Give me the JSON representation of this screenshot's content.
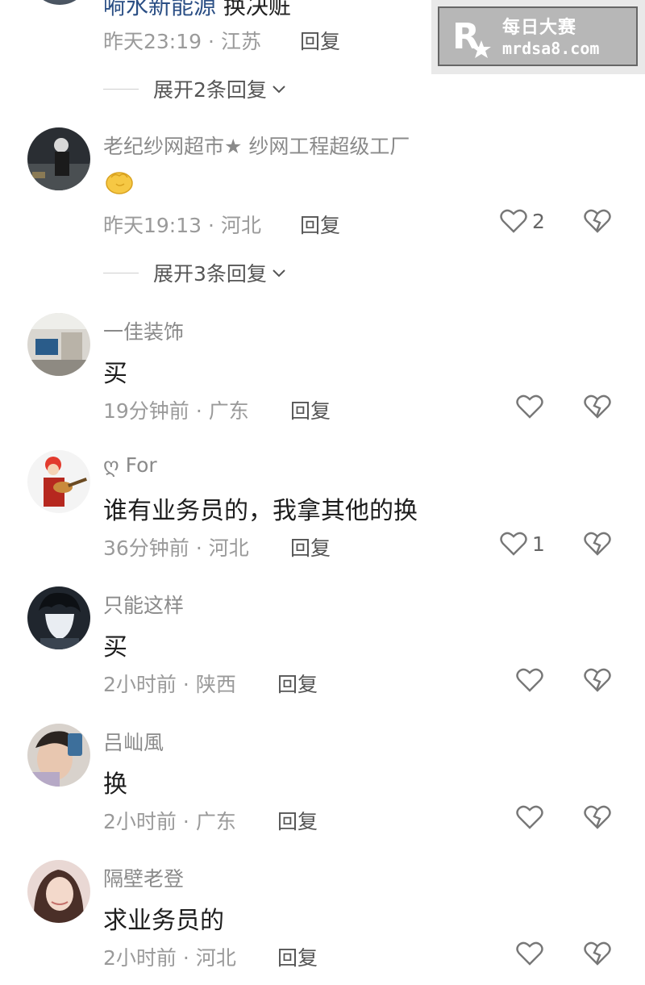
{
  "top_partial": {
    "name_text": "嗬水新能源",
    "rest_text": "换决赃",
    "meta_time": "昨天23:19",
    "meta_region": "江苏",
    "reply_label": "回复",
    "expand_label": "展开2条回复"
  },
  "comments": [
    {
      "username": "老纪纱网超市★ 纱网工程超级工厂",
      "content": "",
      "emoji": "fist-emoji",
      "time": "昨天19:13",
      "region": "河北",
      "reply_label": "回复",
      "like_count": "2",
      "expand_label": "展开3条回复"
    },
    {
      "username": "一佳装饰",
      "content": "买",
      "time": "19分钟前",
      "region": "广东",
      "reply_label": "回复",
      "like_count": ""
    },
    {
      "username": "ღ For",
      "content": "谁有业务员的，我拿其他的换",
      "time": "36分钟前",
      "region": "河北",
      "reply_label": "回复",
      "like_count": "1"
    },
    {
      "username": "只能这样",
      "content": "买",
      "time": "2小时前",
      "region": "陕西",
      "reply_label": "回复",
      "like_count": ""
    },
    {
      "username": "吕屾風",
      "content": "换",
      "time": "2小时前",
      "region": "广东",
      "reply_label": "回复",
      "like_count": ""
    },
    {
      "username": "隔壁老登",
      "content": "求业务员的",
      "time": "2小时前",
      "region": "河北",
      "reply_label": "回复",
      "like_count": ""
    }
  ],
  "meta_separator": "·",
  "watermark": {
    "title": "每日大赛",
    "url": "mrdsa8.com",
    "logo_letter": "R"
  },
  "colors": {
    "username": "#8a8a8a",
    "content": "#1d1d1d",
    "meta": "#9a9a9a",
    "icon": "#777777",
    "link_name": "#2b4f85"
  }
}
